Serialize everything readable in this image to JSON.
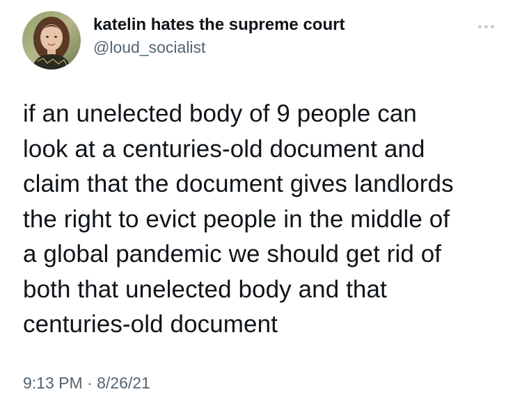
{
  "tweet": {
    "display_name": "katelin hates the supreme court",
    "handle": "@loud_socialist",
    "text_lines": [
      "if an unelected body of 9 people can",
      "look at a centuries-old document and",
      "claim that the document gives landlords",
      "the right to evict people in the middle of",
      "a global pandemic we should get rid of",
      "both that unelected body and that",
      "centuries-old document"
    ],
    "time": "9:13 PM",
    "separator": " · ",
    "date": "8/26/21",
    "more_icon": "more-horizontal-icon"
  },
  "colors": {
    "text_primary": "#0f1419",
    "text_secondary": "#536471",
    "more_dots": "#c4cdd5",
    "background": "#ffffff"
  }
}
